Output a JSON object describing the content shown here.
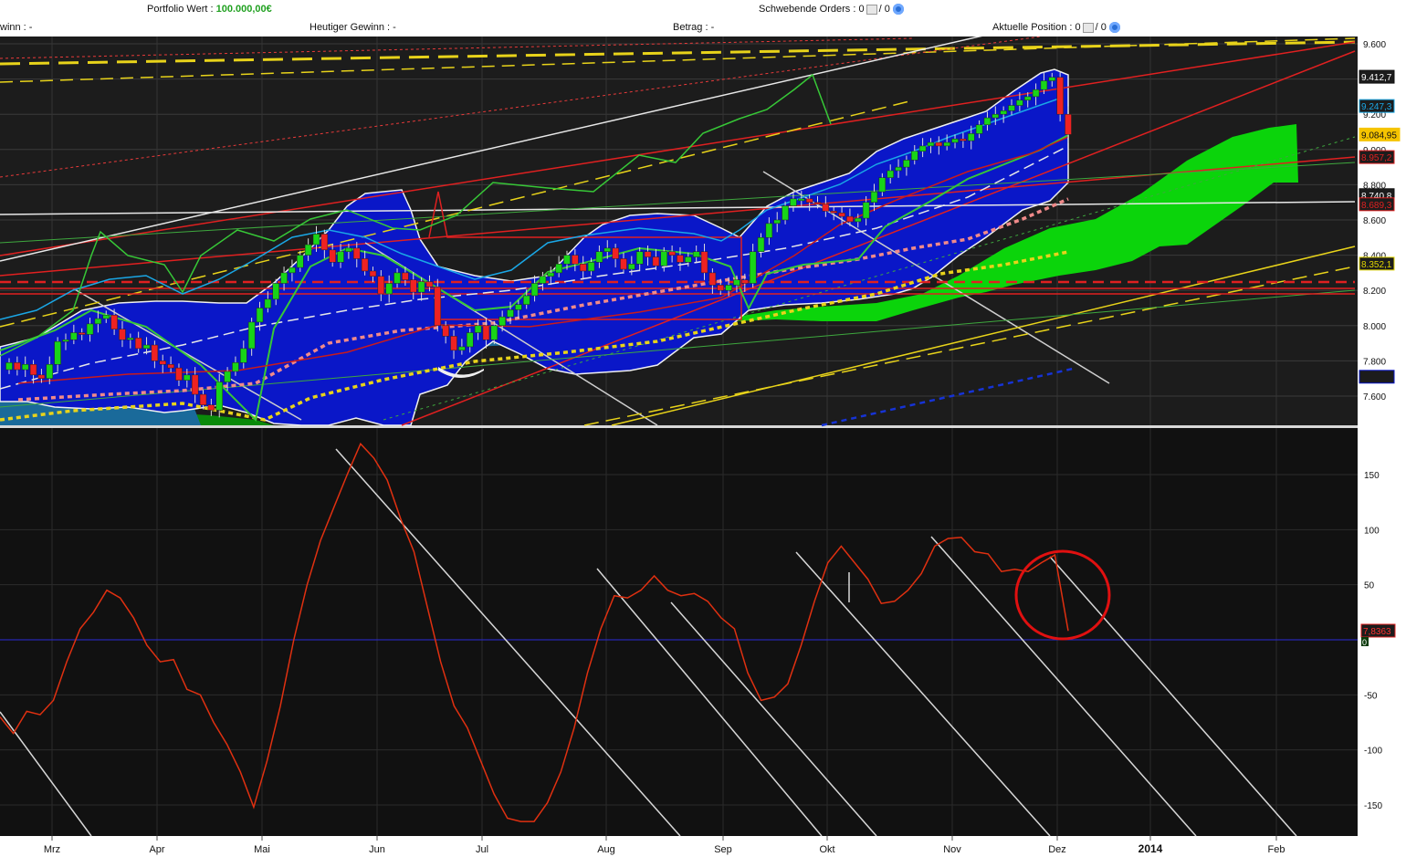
{
  "header": {
    "portfolio_label": "Portfolio Wert :",
    "portfolio_value": "100.000,00€",
    "gewinn_prefix": "winn : -",
    "heutiger_gewinn": "Heutiger Gewinn : -",
    "orders_label": "Schwebende Orders :",
    "orders_a": "0",
    "orders_b": "0",
    "betrag": "Betrag : -",
    "position_label": "Aktuelle Position :",
    "position_a": "0",
    "position_b": "0"
  },
  "colors": {
    "panel_bg": "#1c1c1c",
    "bollinger": "#0a17c8",
    "cloud": "#00e600",
    "up_candle": "#18d418",
    "down_candle": "#ee2222",
    "oscillator": "#e03010",
    "zero_line": "#2b2bd8"
  },
  "chart_data": [
    {
      "type": "candlestick",
      "title": "",
      "y_ticks": [
        "9.600",
        "9.400",
        "9.200",
        "9.000",
        "8.800",
        "8.600",
        "8.400",
        "8.200",
        "8.000",
        "7.800",
        "7.600"
      ],
      "ylim": [
        7450,
        9650
      ],
      "price_labels": [
        {
          "text": "9.412,7",
          "color": "#111111",
          "value": 9413
        },
        {
          "text": "9.247,3",
          "color": "#1aa7e6",
          "value": 9247
        },
        {
          "text": "9.084,95",
          "color": "#f5c400",
          "value": 9085
        },
        {
          "text": "8.957,2",
          "color": "#e02020",
          "value": 8957
        },
        {
          "text": "8.740,8",
          "color": "#111111",
          "value": 8741
        },
        {
          "text": "8.689,3",
          "color": "#e02020",
          "value": 8689
        },
        {
          "text": "8.352,1",
          "color": "#e2d600",
          "value": 8352
        },
        {
          "text": "",
          "color": "#0a17c8",
          "value": 7710
        }
      ],
      "x_months": [
        "Mrz",
        "Apr",
        "Mai",
        "Jun",
        "Jul",
        "Aug",
        "Sep",
        "Okt",
        "Nov",
        "Dez",
        "2014",
        "Feb"
      ],
      "closes": [
        7790,
        7750,
        7780,
        7720,
        7700,
        7780,
        7910,
        7920,
        7960,
        7950,
        8010,
        8040,
        8060,
        7980,
        7920,
        7930,
        7870,
        7890,
        7800,
        7780,
        7760,
        7690,
        7720,
        7610,
        7550,
        7520,
        7680,
        7740,
        7790,
        7870,
        8020,
        8100,
        8150,
        8240,
        8300,
        8330,
        8400,
        8460,
        8520,
        8430,
        8360,
        8420,
        8440,
        8380,
        8310,
        8280,
        8180,
        8240,
        8300,
        8260,
        8190,
        8250,
        8220,
        8000,
        7940,
        7860,
        7880,
        7960,
        8000,
        7920,
        8000,
        8050,
        8090,
        8120,
        8170,
        8240,
        8280,
        8300,
        8350,
        8400,
        8350,
        8310,
        8360,
        8420,
        8440,
        8380,
        8320,
        8350,
        8420,
        8390,
        8340,
        8420,
        8400,
        8360,
        8390,
        8420,
        8300,
        8230,
        8200,
        8230,
        8260,
        8240,
        8420,
        8500,
        8580,
        8600,
        8680,
        8720,
        8720,
        8700,
        8690,
        8650,
        8640,
        8620,
        8590,
        8610,
        8700,
        8760,
        8840,
        8880,
        8900,
        8940,
        8990,
        9020,
        9040,
        9020,
        9040,
        9060,
        9050,
        9090,
        9140,
        9180,
        9200,
        9220,
        9250,
        9280,
        9300,
        9340,
        9390,
        9410,
        9200,
        9085
      ],
      "lines": [
        "ichimoku cloud",
        "bollinger band",
        "trend lines"
      ]
    },
    {
      "type": "line",
      "title": "",
      "y_ticks": [
        "150",
        "100",
        "50",
        "0",
        "-50",
        "-100",
        "-150"
      ],
      "ylim": [
        -178,
        180
      ],
      "current_label": "7,8363",
      "zero_label": "0",
      "values": [
        -70,
        -85,
        -65,
        -68,
        -55,
        -20,
        10,
        25,
        45,
        38,
        20,
        -5,
        -20,
        -18,
        -45,
        -50,
        -75,
        -95,
        -120,
        -152,
        -110,
        -60,
        0,
        50,
        90,
        120,
        150,
        178,
        165,
        145,
        110,
        80,
        30,
        -20,
        -60,
        -80,
        -110,
        -140,
        -162,
        -165,
        -165,
        -148,
        -120,
        -80,
        -30,
        10,
        40,
        38,
        45,
        58,
        45,
        40,
        42,
        35,
        20,
        10,
        -30,
        -55,
        -52,
        -40,
        -5,
        35,
        70,
        85,
        70,
        55,
        33,
        35,
        45,
        60,
        85,
        92,
        93,
        80,
        78,
        62,
        64,
        62,
        70,
        77,
        8
      ],
      "annotation": "circle"
    }
  ]
}
